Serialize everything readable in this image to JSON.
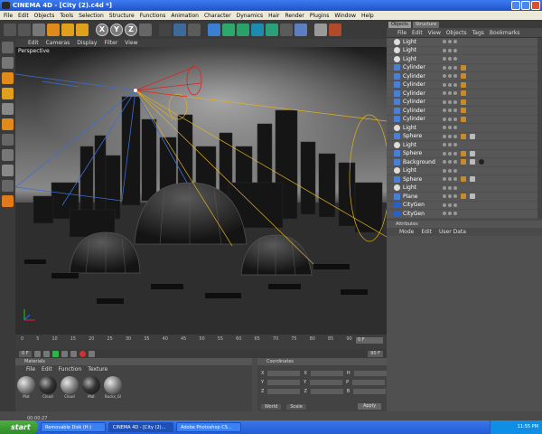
{
  "window": {
    "title": "CINEMA 4D - [City (2).c4d *]"
  },
  "menubar": [
    "File",
    "Edit",
    "Objects",
    "Tools",
    "Selection",
    "Structure",
    "Functions",
    "Animation",
    "Character",
    "Dynamics",
    "Hair",
    "Render",
    "Plugins",
    "Window",
    "Help"
  ],
  "toolbar": {
    "icons": [
      "undo-icon",
      "redo-icon",
      "live-select-icon",
      "move-icon",
      "scale-icon",
      "rotate-icon",
      "x-axis-icon",
      "y-axis-icon",
      "z-axis-icon",
      "coord-system-icon",
      "render-view-icon",
      "render-picture-icon",
      "render-settings-icon",
      "cube-icon",
      "nurbs-icon",
      "array-icon",
      "deformer-icon",
      "scene-icon",
      "light-icon",
      "camera-icon",
      "layout-icon",
      "script-icon"
    ],
    "axis_labels": [
      "X",
      "Y",
      "Z"
    ]
  },
  "viewport": {
    "menu": [
      "Edit",
      "Cameras",
      "Display",
      "Filter",
      "View"
    ],
    "label": "Perspective"
  },
  "timeline": {
    "ticks": [
      "0",
      "5",
      "10",
      "15",
      "20",
      "25",
      "30",
      "35",
      "40",
      "45",
      "50",
      "55",
      "60",
      "65",
      "70",
      "75",
      "80",
      "85",
      "90"
    ],
    "current_frame": "0 F",
    "start_field": "0 F",
    "end_field": "90 F"
  },
  "materials": {
    "header": "Materials",
    "menu": [
      "File",
      "Edit",
      "Function",
      "Texture"
    ],
    "items": [
      "Mat",
      "Cloud",
      "Cloud",
      "Mat",
      "Bucks_Gl"
    ],
    "time": "00:00:27"
  },
  "coordinates": {
    "header": "Coordinates",
    "rows": [
      {
        "a": "X",
        "b": "X",
        "c": "H"
      },
      {
        "a": "Y",
        "b": "Y",
        "c": "P"
      },
      {
        "a": "Z",
        "b": "Z",
        "c": "B"
      }
    ],
    "mode": "World",
    "scale": "Scale",
    "apply": "Apply"
  },
  "object_manager": {
    "tabs": [
      "Objects",
      "Structure"
    ],
    "menu": [
      "File",
      "Edit",
      "View",
      "Objects",
      "Tags",
      "Bookmarks"
    ],
    "objects": [
      {
        "name": "Light",
        "type": "light",
        "tags": 0
      },
      {
        "name": "Light",
        "type": "light",
        "tags": 0
      },
      {
        "name": "Light",
        "type": "light",
        "tags": 0
      },
      {
        "name": "Cylinder",
        "type": "cyl",
        "tags": 1
      },
      {
        "name": "Cylinder",
        "type": "cyl",
        "tags": 1
      },
      {
        "name": "Cylinder",
        "type": "cyl",
        "tags": 1
      },
      {
        "name": "Cylinder",
        "type": "cyl",
        "tags": 1
      },
      {
        "name": "Cylinder",
        "type": "cyl",
        "tags": 1
      },
      {
        "name": "Cylinder",
        "type": "cyl",
        "tags": 1
      },
      {
        "name": "Cylinder",
        "type": "cyl",
        "tags": 1
      },
      {
        "name": "Light",
        "type": "light",
        "tags": 0
      },
      {
        "name": "Sphere",
        "type": "sphere",
        "tags": 2
      },
      {
        "name": "Light",
        "type": "light",
        "tags": 0
      },
      {
        "name": "Sphere",
        "type": "sphere",
        "tags": 2
      },
      {
        "name": "Background",
        "type": "bg",
        "tags": 3
      },
      {
        "name": "Light",
        "type": "light",
        "tags": 0
      },
      {
        "name": "Sphere",
        "type": "sphere",
        "tags": 2
      },
      {
        "name": "Light",
        "type": "light",
        "tags": 0
      },
      {
        "name": "Plane",
        "type": "plane",
        "tags": 2
      },
      {
        "name": "CityGen",
        "type": "gen",
        "tags": 0
      },
      {
        "name": "CityGen",
        "type": "gen",
        "tags": 0
      }
    ]
  },
  "attributes": {
    "header": "Attributes",
    "menu": [
      "Mode",
      "Edit",
      "User Data"
    ]
  },
  "taskbar": {
    "start": "start",
    "tasks": [
      "Removable Disk (H:)",
      "CINEMA 4D - [City (2)...",
      "Adobe Photoshop CS..."
    ],
    "clock": "11:55 PM"
  },
  "colors": {
    "titlebar": "#2c63dc",
    "viewport_bg": "#222222",
    "light_rays": "#e0b020",
    "camera": "#3b6fd4"
  }
}
